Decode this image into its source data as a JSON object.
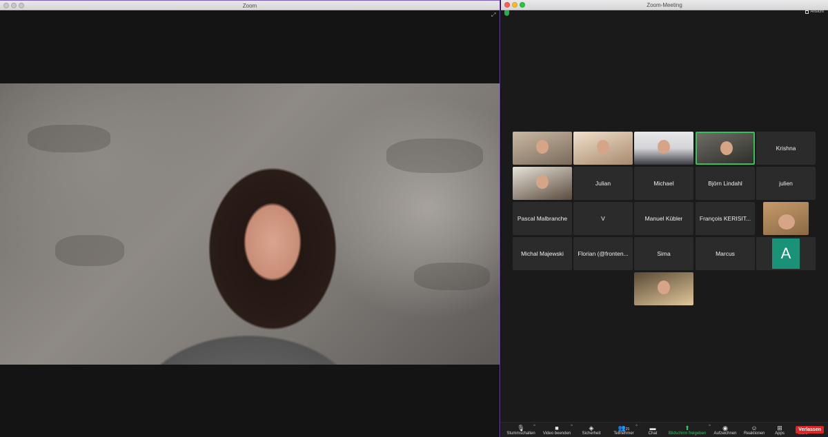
{
  "left_window": {
    "title": "Zoom"
  },
  "right_window": {
    "title": "Zoom-Meeting",
    "view_label": "Ansicht",
    "tiles": [
      {
        "name": "",
        "video": true,
        "style": "v1"
      },
      {
        "name": "",
        "video": true,
        "style": "v2"
      },
      {
        "name": "",
        "video": true,
        "style": "v3"
      },
      {
        "name": "",
        "video": true,
        "style": "v4",
        "active": true
      },
      {
        "name": "Krishna"
      },
      {
        "name": "",
        "video": true,
        "style": "v5"
      },
      {
        "name": "Julian"
      },
      {
        "name": "Michael"
      },
      {
        "name": "Björn Lindahl"
      },
      {
        "name": "julien"
      },
      {
        "name": "Pascal Malbranche"
      },
      {
        "name": "V"
      },
      {
        "name": "Manuel Kübler"
      },
      {
        "name": "François KERISIT..."
      },
      {
        "name": "",
        "video": true,
        "style": "v6"
      },
      {
        "name": "Michal Majewski"
      },
      {
        "name": "Florian (@fronten..."
      },
      {
        "name": "Sima"
      },
      {
        "name": "Marcus"
      },
      {
        "name": "",
        "avatar_letter": "A"
      },
      {
        "name": "",
        "video": true,
        "style": "v7"
      }
    ],
    "toolbar": {
      "mute": "Stummschalten",
      "video": "Video beenden",
      "security": "Sicherheit",
      "participants": "Teilnehmer",
      "participants_count": "21",
      "chat": "Chat",
      "share": "Bildschirm freigeben",
      "record": "Aufzeichnen",
      "reactions": "Reaktionen",
      "apps": "Apps",
      "more": "Mehr",
      "leave": "Verlassen"
    }
  }
}
